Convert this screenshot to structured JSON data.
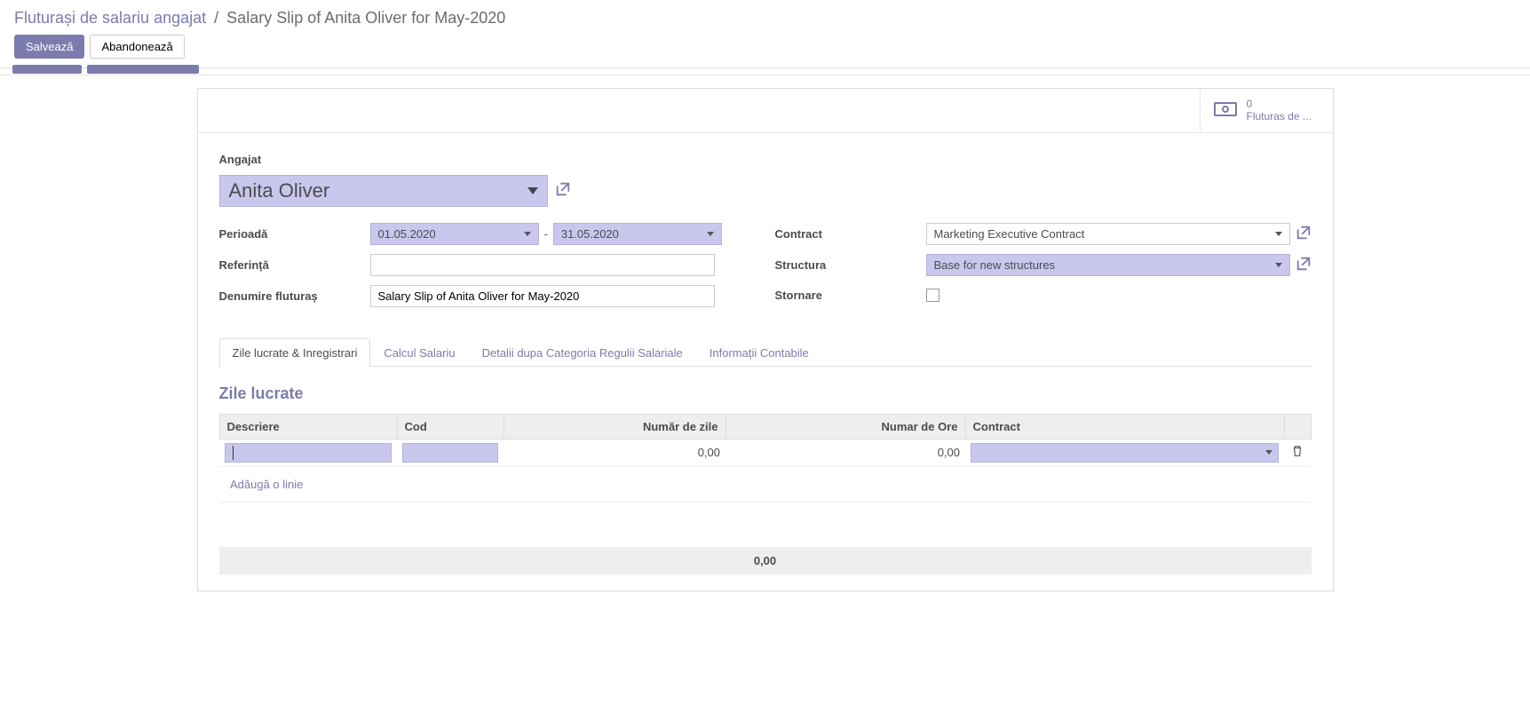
{
  "breadcrumb": {
    "parent": "Fluturași de salariu angajat",
    "current": "Salary Slip of Anita Oliver for May-2020"
  },
  "actions": {
    "save": "Salvează",
    "discard": "Abandonează"
  },
  "stat": {
    "count": "0",
    "label": "Fluturas de ..."
  },
  "labels": {
    "employee": "Angajat",
    "period": "Perioadă",
    "reference": "Referință",
    "slip_name": "Denumire fluturaș",
    "contract": "Contract",
    "structure": "Structura",
    "reversal": "Stornare"
  },
  "values": {
    "employee": "Anita Oliver",
    "date_from": "01.05.2020",
    "date_to": "31.05.2020",
    "reference": "",
    "slip_name": "Salary Slip of Anita Oliver for May-2020",
    "contract": "Marketing Executive Contract",
    "structure": "Base for new structures"
  },
  "tabs": {
    "worked": "Zile lucrate & Inregistrari",
    "calc": "Calcul Salariu",
    "details": "Detalii dupa Categoria Regulii Salariale",
    "accounting": "Informații Contabile"
  },
  "worked_days": {
    "title": "Zile lucrate",
    "headers": {
      "desc": "Descriere",
      "code": "Cod",
      "days": "Număr de zile",
      "hours": "Numar de Ore",
      "contract": "Contract"
    },
    "row": {
      "days": "0,00",
      "hours": "0,00"
    },
    "add_line": "Adăugă o linie",
    "total": "0,00"
  }
}
